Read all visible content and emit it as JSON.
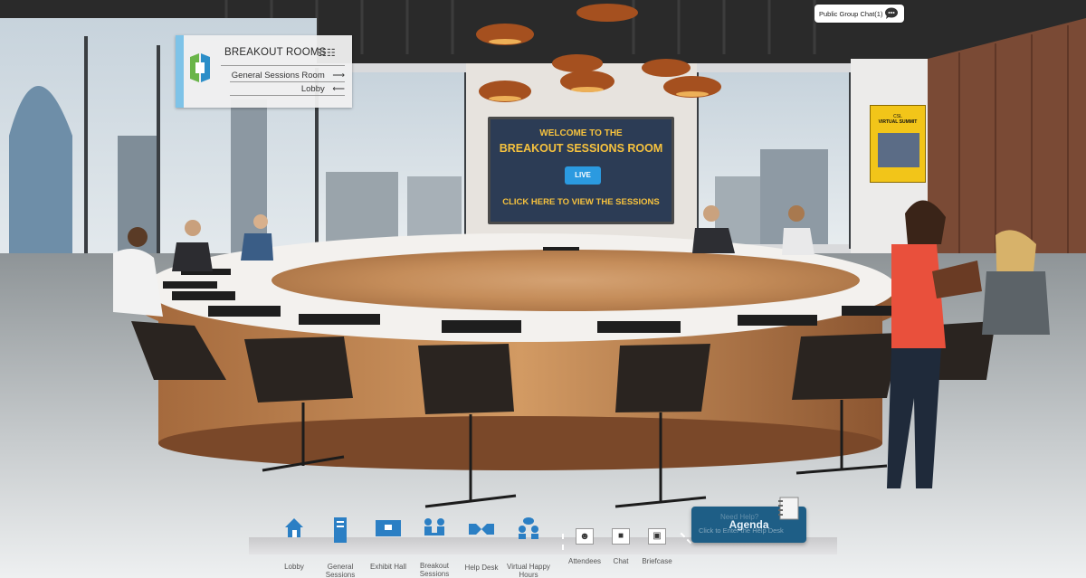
{
  "chat": {
    "label": "Public Group Chat(1)"
  },
  "sign": {
    "title": "BREAKOUT ROOMS",
    "links": [
      {
        "label": "General Sessions Room",
        "arrow": "⟶"
      },
      {
        "label": "Lobby",
        "arrow": "⟵"
      }
    ]
  },
  "screen": {
    "line1": "WELCOME TO THE",
    "line2": "BREAKOUT SESSIONS ROOM",
    "live": "LIVE",
    "line3": "CLICK HERE TO VIEW THE SESSIONS"
  },
  "poster": {
    "line1": "CSL",
    "line2": "VIRTUAL SUMMIT"
  },
  "nav": {
    "items": [
      {
        "label": "Lobby",
        "icon": "house-icon"
      },
      {
        "label": "General Sessions",
        "icon": "building-icon"
      },
      {
        "label": "Exhibit Hall",
        "icon": "booth-icon"
      },
      {
        "label": "Breakout Sessions",
        "icon": "group-icon"
      },
      {
        "label": "Help Desk",
        "icon": "handshake-icon"
      },
      {
        "label": "Virtual Happy Hours",
        "icon": "people-chat-icon"
      },
      {
        "label": "Attendees",
        "icon": "attendees-icon"
      },
      {
        "label": "Chat",
        "icon": "chat-icon"
      },
      {
        "label": "Briefcase",
        "icon": "briefcase-icon"
      }
    ],
    "agenda": "Agenda",
    "agenda_hint": "Click to Enter the Help Desk",
    "agenda_hint2": "Need Help?"
  },
  "colors": {
    "accent": "#2b7fc4",
    "nav_base": "#d4d4d6",
    "agenda_bg": "#1e5e86"
  }
}
